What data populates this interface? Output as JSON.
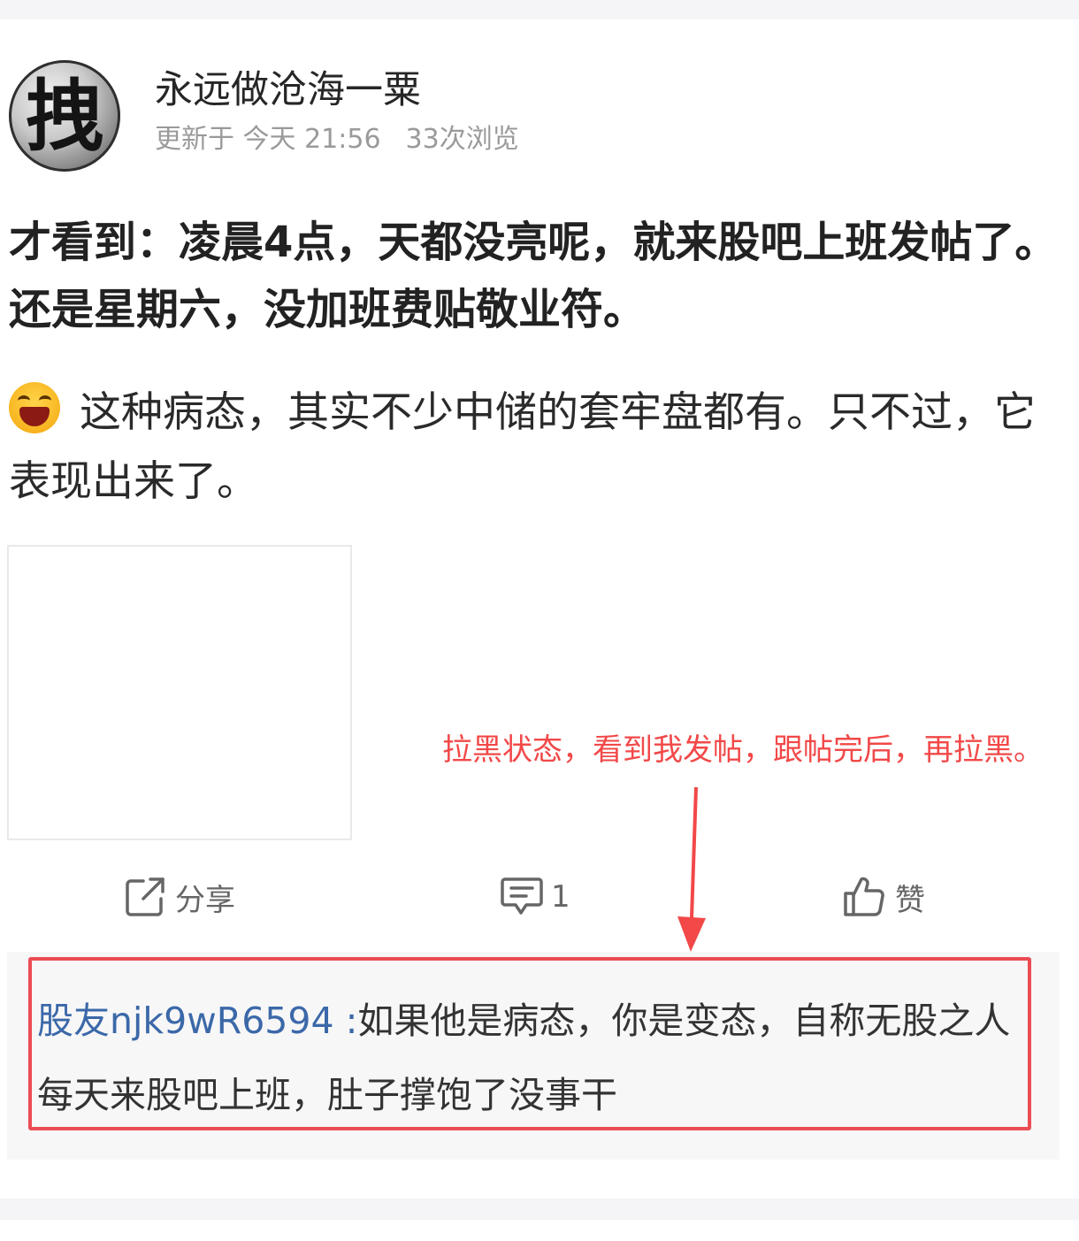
{
  "author": {
    "avatar_glyph": "拽",
    "name": "永远做沧海一粟",
    "updated_label": "更新于 今天 21:56",
    "views": "33次浏览"
  },
  "post": {
    "title": "才看到：凌晨4点，天都没亮呢，就来股吧上班发帖了。还是星期六，没加班费贴敬业符。",
    "emoji": "laughing-emoji",
    "body": "这种病态，其实不少中储的套牢盘都有。只不过，它表现出来了。"
  },
  "annotation": {
    "text": "拉黑状态，看到我发帖，跟帖完后，再拉黑。",
    "color": "#f24848"
  },
  "actions": {
    "share": {
      "icon": "share-icon",
      "label": "分享"
    },
    "comment": {
      "icon": "comment-icon",
      "count": "1"
    },
    "like": {
      "icon": "thumbs-up-icon",
      "label": "赞"
    }
  },
  "comments": [
    {
      "user": "股友njk9wR6594 :",
      "text": "如果他是病态，你是变态，自称无股之人每天来股吧上班，肚子撑饱了没事干"
    }
  ],
  "colors": {
    "link": "#3b68a8",
    "highlight_border": "#ec4c53",
    "meta_text": "#9a9a9a"
  }
}
